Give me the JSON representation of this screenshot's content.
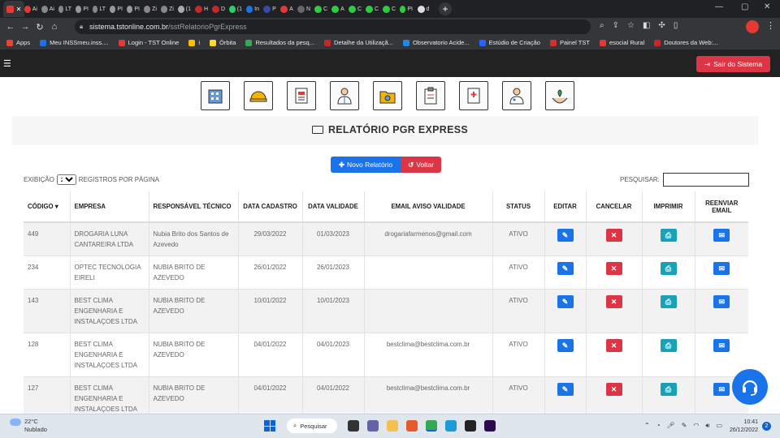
{
  "browser": {
    "tabs": [
      "Ai",
      "Ai",
      "LT",
      "PI",
      "LT",
      "PI",
      "PI",
      "Zi",
      "Zi",
      "(1",
      "H",
      "D",
      "(1",
      "In",
      "P",
      "A",
      "N",
      "C",
      "A",
      "C",
      "C",
      "C",
      "PI",
      "d"
    ],
    "url_host": "sistema.tstonline.com.br",
    "url_path": "/sstRelatorioPgrExpress",
    "bookmarks": [
      "Apps",
      "Meu INSSmeu.inss....",
      "Login - TST Online",
      "i",
      "Órbita",
      "Resultados da pesq...",
      "Detalhe da Utilizaçã...",
      "Observatorio Acide...",
      "Estúdio de Criação",
      "Painel TST",
      "esocial Rural",
      "Doutores da Web:..."
    ]
  },
  "header": {
    "logout_label": "Sair do Sistema"
  },
  "modules": [
    "building-icon",
    "helmet-icon",
    "report-icon",
    "doctor-icon",
    "folder-icon",
    "clipboard-icon",
    "medical-file-icon",
    "physician-icon",
    "plant-hands-icon"
  ],
  "page": {
    "title": "RELATÓRIO PGR EXPRESS",
    "new_button": "Novo Relatório",
    "back_button": "Voltar",
    "show_label": "EXIBIÇÃO",
    "per_page_value": "20",
    "per_page_label": "REGISTROS POR PÁGINA",
    "search_label": "PESQUISAR:",
    "search_value": ""
  },
  "table": {
    "headers": {
      "codigo": "CÓDIGO",
      "empresa": "EMPRESA",
      "responsavel": "RESPONSÁVEL TÉCNICO",
      "cadastro": "DATA CADASTRO",
      "validade": "DATA VALIDADE",
      "email": "EMAIL AVISO VALIDADE",
      "status": "STATUS",
      "editar": "EDITAR",
      "cancelar": "CANCELAR",
      "imprimir": "IMPRIMIR",
      "reenviar": "REENVIAR EMAIL"
    },
    "rows": [
      {
        "codigo": "449",
        "empresa": "DROGARIA LUNA CANTAREIRA LTDA",
        "responsavel": "Nubia Brito dos Santos de Azevedo",
        "cadastro": "29/03/2022",
        "validade": "01/03/2023",
        "email": "drogariafarmenos@gmail.com",
        "status": "ATIVO"
      },
      {
        "codigo": "234",
        "empresa": "OPTEC TECNOLOGIA EIRELI",
        "responsavel": "NUBIA BRITO DE AZEVEDO",
        "cadastro": "26/01/2022",
        "validade": "26/01/2023",
        "email": "",
        "status": "ATIVO"
      },
      {
        "codigo": "143",
        "empresa": "BEST CLIMA ENGENHARIA E INSTALAÇOES LTDA",
        "responsavel": "NUBIA BRITO DE AZEVEDO",
        "cadastro": "10/01/2022",
        "validade": "10/01/2023",
        "email": "",
        "status": "ATIVO"
      },
      {
        "codigo": "128",
        "empresa": "BEST CLIMA ENGENHARIA E INSTALAÇOES LTDA",
        "responsavel": "NUBIA BRITO DE AZEVEDO",
        "cadastro": "04/01/2022",
        "validade": "04/01/2023",
        "email": "bestclima@bestclima.com.br",
        "status": "ATIVO"
      },
      {
        "codigo": "127",
        "empresa": "BEST CLIMA ENGENHARIA E INSTALAÇOES LTDA",
        "responsavel": "NUBIA BRITO DE AZEVEDO",
        "cadastro": "04/01/2022",
        "validade": "04/01/2022",
        "email": "bestclima@bestclima.com.br",
        "status": "ATIVO"
      }
    ]
  },
  "taskbar": {
    "temperature": "22°C",
    "weather": "Nublado",
    "search_label": "Pesquisar",
    "time": "10:41",
    "date": "26/12/2022",
    "notifications": "2"
  }
}
